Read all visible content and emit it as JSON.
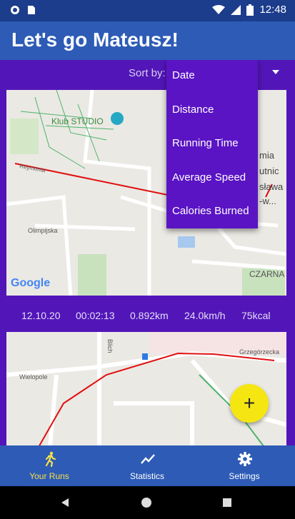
{
  "status_bar": {
    "time": "12:48",
    "icons": [
      "circle-icon",
      "sim-icon",
      "wifi-icon",
      "signal-icon",
      "battery-icon"
    ]
  },
  "app_bar": {
    "title": "Let's go Mateusz!"
  },
  "sort": {
    "label": "Sort by:",
    "options": [
      "Date",
      "Distance",
      "Running Time",
      "Average Speed",
      "Calories Burned"
    ]
  },
  "map1": {
    "labels": {
      "poi": "Klub STUDIO",
      "street1": "Reymonta",
      "street2": "Olimpijska",
      "district": "CZARNA",
      "partial1": "mia",
      "partial2": "utnic",
      "partial3": "sława",
      "partial4": "-w..."
    },
    "logo": "Google"
  },
  "run": {
    "date": "12.10.20",
    "time": "00:02:13",
    "distance": "0.892km",
    "speed": "24.0km/h",
    "calories": "75kcal"
  },
  "map2": {
    "labels": {
      "street1": "Wielopole",
      "street2": "Blich",
      "street3": "Grzegórzecka"
    }
  },
  "fab": {
    "symbol": "+"
  },
  "bottom_nav": {
    "items": [
      {
        "label": "Your Runs",
        "icon": "runner-icon"
      },
      {
        "label": "Statistics",
        "icon": "chart-icon"
      },
      {
        "label": "Settings",
        "icon": "gear-icon"
      }
    ]
  },
  "colors": {
    "status_bar": "#1c3c8c",
    "app_bar": "#2d5bb6",
    "content_bg": "#5216b8",
    "dropdown_bg": "#5a14c4",
    "fab": "#f5e612",
    "active_nav": "#f6e04a",
    "route": "#e01010"
  }
}
